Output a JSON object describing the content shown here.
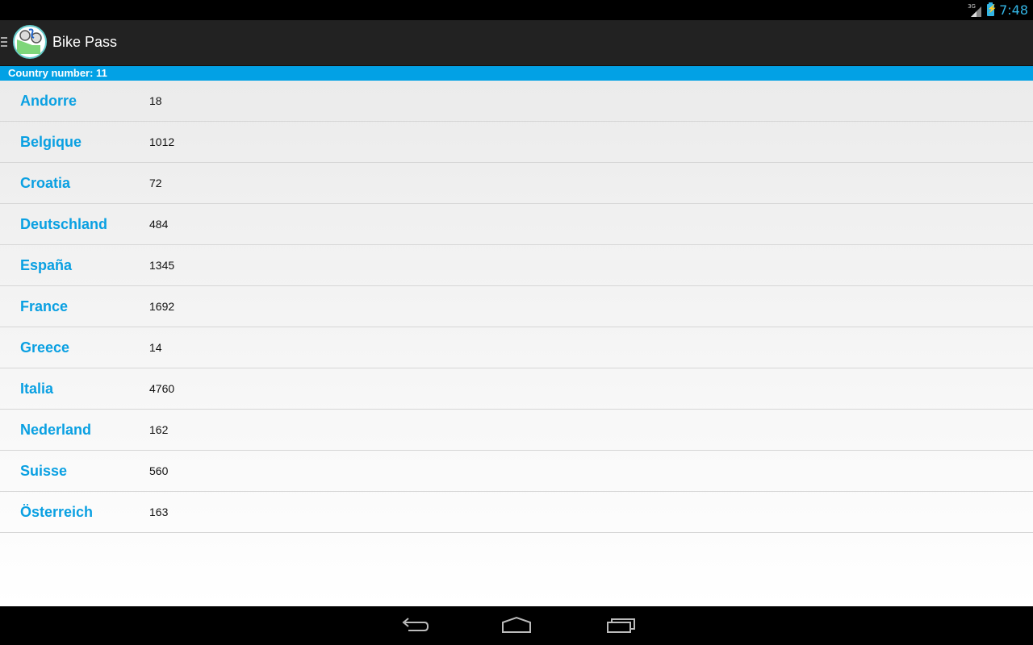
{
  "status_bar": {
    "network_type": "3G",
    "time": "7:48",
    "icons": [
      "signal-icon",
      "battery-charging-icon"
    ]
  },
  "action_bar": {
    "title": "Bike Pass",
    "icon": "bike-pass-app-icon",
    "drawer_indicator": "menu-icon"
  },
  "info_bar": {
    "text": "Country number: 11"
  },
  "countries": [
    {
      "name": "Andorre",
      "count": "18"
    },
    {
      "name": "Belgique",
      "count": "1012"
    },
    {
      "name": "Croatia",
      "count": "72"
    },
    {
      "name": "Deutschland",
      "count": "484"
    },
    {
      "name": "España",
      "count": "1345"
    },
    {
      "name": "France",
      "count": "1692"
    },
    {
      "name": "Greece",
      "count": "14"
    },
    {
      "name": "Italia",
      "count": "4760"
    },
    {
      "name": "Nederland",
      "count": "162"
    },
    {
      "name": "Suisse",
      "count": "560"
    },
    {
      "name": "Österreich",
      "count": "163"
    }
  ],
  "nav_bar": {
    "buttons": [
      "back-icon",
      "home-icon",
      "recent-apps-icon"
    ]
  },
  "colors": {
    "accent": "#02a1e5",
    "country_name": "#0aa0e2",
    "action_bar": "#222222",
    "status_time": "#33b5e5"
  }
}
